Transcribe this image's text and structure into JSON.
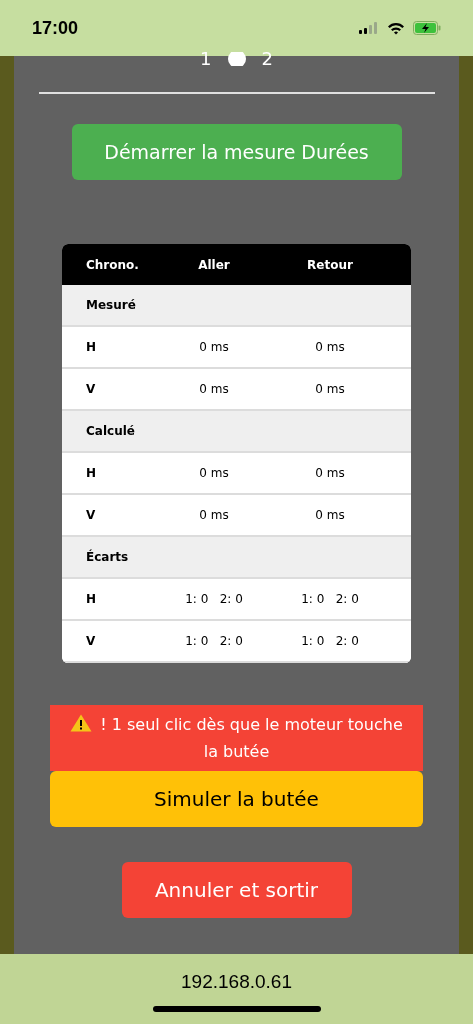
{
  "status_bar": {
    "time": "17:00"
  },
  "switch": {
    "left_label": "1",
    "right_label": "2"
  },
  "start_button": "Démarrer la mesure Durées",
  "table": {
    "columns": [
      "Chrono.",
      "Aller",
      "Retour"
    ],
    "rows": [
      {
        "kind": "section",
        "label": "Mesuré"
      },
      {
        "kind": "data",
        "label": "H",
        "aller": "0 ms",
        "retour": "0 ms"
      },
      {
        "kind": "data",
        "label": "V",
        "aller": "0 ms",
        "retour": "0 ms"
      },
      {
        "kind": "section",
        "label": "Calculé"
      },
      {
        "kind": "data",
        "label": "H",
        "aller": "0 ms",
        "retour": "0 ms"
      },
      {
        "kind": "data",
        "label": "V",
        "aller": "0 ms",
        "retour": "0 ms"
      },
      {
        "kind": "section",
        "label": "Écarts"
      },
      {
        "kind": "data",
        "label": "H",
        "aller": "1: 0   2: 0",
        "retour": "1: 0   2: 0"
      },
      {
        "kind": "data",
        "label": "V",
        "aller": "1: 0   2: 0",
        "retour": "1: 0   2: 0"
      }
    ]
  },
  "warning": "! 1 seul clic dès que le moteur touche la butée",
  "simulate_button": "Simuler la butée",
  "cancel_button": "Annuler et sortir",
  "address": "192.168.0.61"
}
